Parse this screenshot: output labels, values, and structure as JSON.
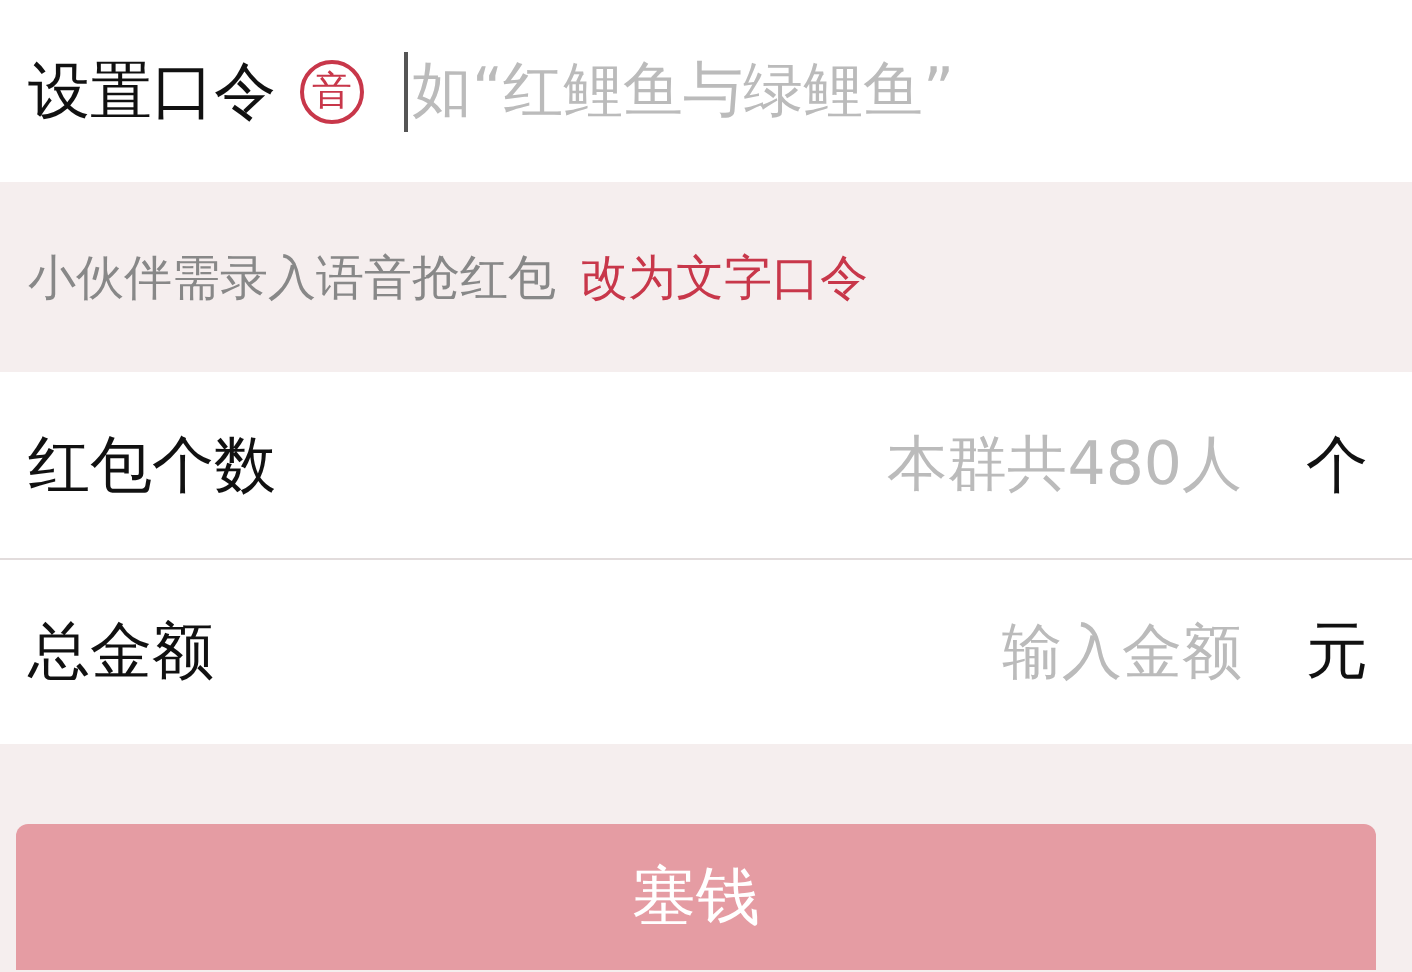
{
  "command_row": {
    "label": "设置口令",
    "badge": "音",
    "placeholder": "如“红鲤鱼与绿鲤鱼”"
  },
  "hint": {
    "text": "小伙伴需录入语音抢红包",
    "link": "改为文字口令"
  },
  "fields": [
    {
      "label": "红包个数",
      "placeholder": "本群共480人",
      "unit": "个"
    },
    {
      "label": "总金额",
      "placeholder": "输入金额",
      "unit": "元"
    }
  ],
  "submit_button": "塞钱"
}
